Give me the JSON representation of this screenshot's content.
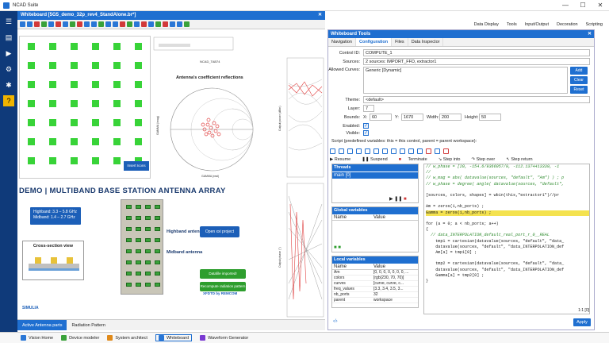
{
  "app": {
    "title": "NCAD Suite"
  },
  "window_controls": {
    "minimize": "—",
    "maximize": "☐",
    "close": "✕"
  },
  "whiteboard": {
    "header": "Whiteboard [5G5_demo_32p_rev4_StandAlone.br*]",
    "close": "✕",
    "smith_title": "Antenna's coefficient reflections",
    "smith_axis_x": "GAMMA (real)",
    "smith_axis_y": "GAMMA (imag)",
    "ncad_label": "NCAD_TAB74",
    "insert_button": "Insert Icons",
    "rightplot_axis_y": "Output power (dBm)",
    "rightplot2_axis_y": "Output phase (°)",
    "banner_title": "DEMO | MULTIBAND BASE STATION ANTENNA ARRAY",
    "info_line1": "Highband: 3.3 – 5.8 GHz",
    "info_line2": "Midband: 1.4 – 2.7 GHz",
    "cross_section": "Cross-section view",
    "highband": "Highband antenna",
    "midband": "Midband antenna",
    "open_project": "Open xxi project",
    "datafile": "Datafile imported!",
    "recompute": "Recompute radiation pattern",
    "xfdtd": "XFDTD by REMCOM",
    "simulia": "SIMULIA"
  },
  "bottom_tabs": [
    "Active Antenna parts",
    "Radiation Pattern"
  ],
  "main_toolbar": [
    "Data Display",
    "Tools",
    "Input/Output",
    "Decoration",
    "Scripting"
  ],
  "tools": {
    "header": "Whiteboard Tools",
    "tabs": [
      "Navigation",
      "Configuration",
      "Files",
      "Data Inspector"
    ],
    "control_id_label": "Control ID:",
    "control_id": "COMPUTE_1",
    "sources_label": "Sources:",
    "sources": "2 sources: IMPORT_FFD, extractor1",
    "allowed_label": "Allowed Curves:",
    "allowed": "Generic [Dynamic]",
    "add": "Add",
    "clear": "Clear",
    "reset": "Reset",
    "theme_label": "Theme:",
    "theme": "<default>",
    "layer_label": "Layer:",
    "layer": "7",
    "bounds_label": "Bounds:",
    "bx": "60",
    "by": "1670",
    "bw": "200",
    "bh": "50",
    "bx_label": "X:",
    "by_label": "Y:",
    "bw_label": "Width:",
    "bh_label": "Height:",
    "enabled_label": "Enabled:",
    "visible_label": "Visible:",
    "check": "✓",
    "script_label": "Script (predefined variables: this = this control, parent = parent workspace):",
    "resume": "Resume",
    "suspend": "Suspend",
    "terminate": "Terminate",
    "step_into": "Step into",
    "step_over": "Step over",
    "step_return": "Step return",
    "threads": "Threads",
    "thread_main": "main [0]",
    "global_vars": "Global variables",
    "local_vars": "Local variables",
    "col_name": "Name",
    "col_value": "Value",
    "locals": [
      [
        "Am",
        "[0, 0, 0, 0, 0, 0, 0, ..."
      ],
      [
        "colors",
        "[rgb(230, 70, 70)]"
      ],
      [
        "curves",
        "[curve, curve, c..."
      ],
      [
        "freq_values",
        "[3.3, 3.4, 3.5, 3..."
      ],
      [
        "nb_ports",
        "32"
      ],
      [
        "parent",
        "workspace"
      ]
    ],
    "cursor_pos": "1:1 [0]",
    "apply": "Apply",
    "code_lines": [
      {
        "t": "// w_phase = [20, -154.6/9366057/9, -112.1374413339, -1",
        "c": "cm"
      },
      {
        "t": "//",
        "c": "cm"
      },
      {
        "t": "// w_mag = abs( datavalue(sources, \"default\", \"Am\") ) ; p",
        "c": "cm"
      },
      {
        "t": "// w_phase = degree( angle( datavalue(sources, \"default\",",
        "c": "cm"
      },
      {
        "t": "",
        "c": ""
      },
      {
        "t": "[sources, colors, shapes] = wbin(this,\"extractor1\")//pr",
        "c": ""
      },
      {
        "t": "",
        "c": ""
      },
      {
        "t": "Am = zeros(1,nb_ports) ;",
        "c": ""
      },
      {
        "t": "Gamma = zeros(1,nb_ports) ;",
        "c": "hl"
      },
      {
        "t": "",
        "c": ""
      },
      {
        "t": "for (a = 0; a < nb_ports; a++)",
        "c": ""
      },
      {
        "t": "{",
        "c": ""
      },
      {
        "t": "  // data_INTERPOLATION_default_real_port_r_0__REAL",
        "c": "cm"
      },
      {
        "t": "    tmp1 = cartesian(datavalue(sources, \"default\", \"data_",
        "c": ""
      },
      {
        "t": "    datavalue(sources, \"default\", \"data_INTERPOLATION_def",
        "c": ""
      },
      {
        "t": "    Am[a] = tmp1[0] ;",
        "c": ""
      },
      {
        "t": "",
        "c": ""
      },
      {
        "t": "    tmp2 = cartesian(datavalue(sources, \"default\", \"data_",
        "c": ""
      },
      {
        "t": "    datavalue(sources, \"default\", \"data_INTERPOLATION_def",
        "c": ""
      },
      {
        "t": "    Gamma[a] = tmp2[0] ;",
        "c": ""
      },
      {
        "t": "}",
        "c": ""
      }
    ]
  },
  "taskbar": [
    "Vision Home",
    "Device modeler",
    "System architect",
    "Whiteboard",
    "Waveform Generator"
  ]
}
